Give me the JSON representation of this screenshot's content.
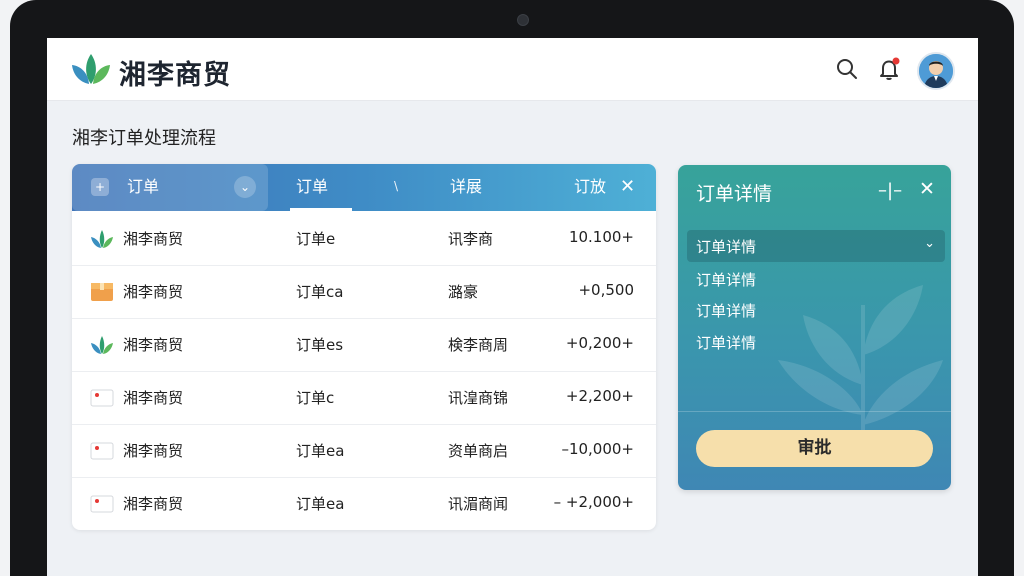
{
  "app": {
    "brand": "湘李商贸"
  },
  "page": {
    "title": "湘李订单处理流程"
  },
  "table": {
    "headers": {
      "col1": "订单",
      "col2": "订单",
      "col3": "详展",
      "col4": "订放",
      "close": "✕"
    },
    "rows": [
      {
        "icon": "leaf-logo-icon",
        "name": "湘李商贸",
        "order": "订单e",
        "vendor": "讯李商",
        "amount": "10.100+"
      },
      {
        "icon": "box-icon",
        "name": "湘李商贸",
        "order": "订单ca",
        "vendor": "潞豪",
        "amount": "+0,500"
      },
      {
        "icon": "leaf-logo-icon",
        "name": "湘李商贸",
        "order": "订单es",
        "vendor": "検李商周",
        "amount": "+0,200+"
      },
      {
        "icon": "flag-icon",
        "name": "湘李商贸",
        "order": "订单c",
        "vendor": "讯湟商锦",
        "amount": "+2,200+"
      },
      {
        "icon": "flag-icon",
        "name": "湘李商贸",
        "order": "订单ea",
        "vendor": "资单商启",
        "amount": "–10,000+"
      },
      {
        "icon": "flag-icon",
        "name": "湘李商贸",
        "order": "订单ea",
        "vendor": "讯湄商闻",
        "amount": "– +2,000+"
      }
    ]
  },
  "detail": {
    "title": "订单详情",
    "minimize": "–|–",
    "close": "✕",
    "select_value": "订单详情",
    "options": [
      "订单详情",
      "订单详情",
      "订单详情"
    ],
    "approve_label": "审批"
  },
  "colors": {
    "accent": "#3f8cc6",
    "panel": "#3a96ad",
    "approve": "#f6dfab",
    "notify": "#e53935"
  }
}
